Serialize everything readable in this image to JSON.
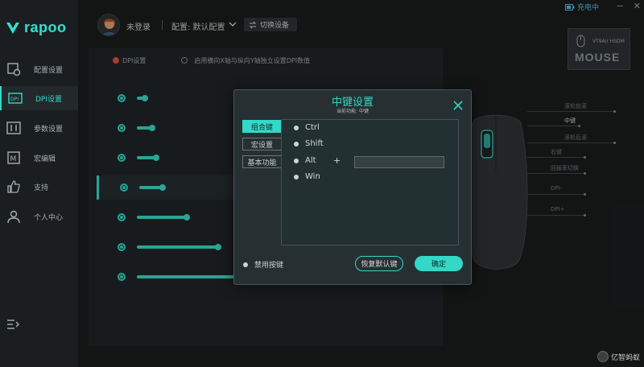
{
  "brand": {
    "name": "rapoo",
    "accent": "#33d8c6"
  },
  "sidebar": {
    "items": [
      {
        "label": "配置设置",
        "icon": "config-icon"
      },
      {
        "label": "DPI设置",
        "icon": "dpi-icon",
        "active": true
      },
      {
        "label": "参数设置",
        "icon": "params-icon"
      },
      {
        "label": "宏编辑",
        "icon": "macro-icon"
      },
      {
        "label": "支持",
        "icon": "thumbs-up-icon"
      },
      {
        "label": "个人中心",
        "icon": "user-icon"
      }
    ]
  },
  "header": {
    "login_status": "未登录",
    "config_label": "配置: 默认配置",
    "switch_device": "切换设备",
    "charging": "充电中"
  },
  "device": {
    "model": "VT9Air HSDM",
    "type": "MOUSE"
  },
  "dpi": {
    "header_option": "DPI设置",
    "independent_xy": "启用横向X轴与纵向Y轴独立设置DPI数值",
    "levels": [
      0.04,
      0.08,
      0.1,
      0.12,
      0.26,
      0.42,
      1.0
    ],
    "active_index": 3
  },
  "mouse_diagram": {
    "labels": [
      "滚轮前滚",
      "中键",
      "滚轮后滚",
      "右键",
      "回报率切换",
      "DPI-",
      "DPI+"
    ],
    "highlight_index": 1
  },
  "modal": {
    "title": "中键设置",
    "subtitle": "当前功能: 中键",
    "tabs": [
      {
        "label": "组合键",
        "active": true
      },
      {
        "label": "宏设置"
      },
      {
        "label": "基本功能"
      }
    ],
    "modifiers": [
      "Ctrl",
      "Shift",
      "Alt",
      "Win"
    ],
    "plus": "+",
    "key_value": "",
    "disable_key": "禁用按键",
    "restore_default": "恢复默认键",
    "confirm": "确定"
  },
  "watermark": "亿智蚂蚁"
}
